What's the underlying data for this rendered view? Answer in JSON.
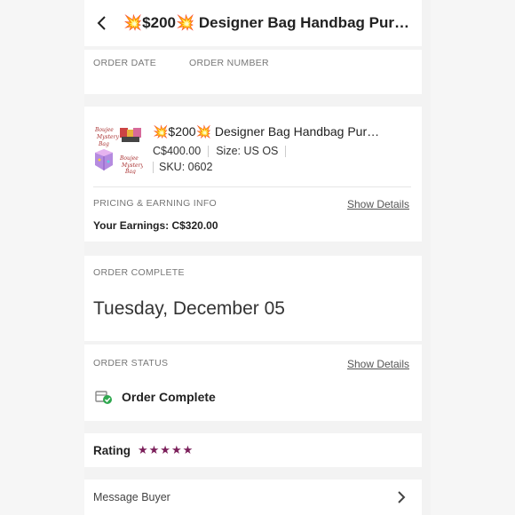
{
  "header": {
    "title": "💥$200💥 Designer Bag Handbag Purse…"
  },
  "meta": {
    "order_date_label": "ORDER DATE",
    "order_number_label": "ORDER NUMBER"
  },
  "product": {
    "name": "💥$200💥 Designer Bag Handbag Pur…",
    "price": "C$400.00",
    "size": "Size: US OS",
    "sku": "SKU: 0602"
  },
  "pricing": {
    "label": "PRICING & EARNING INFO",
    "show_details": "Show Details",
    "earnings": "Your Earnings: C$320.00"
  },
  "order_complete": {
    "label": "ORDER COMPLETE",
    "date": "Tuesday, December 05"
  },
  "order_status": {
    "label": "ORDER STATUS",
    "show_details": "Show Details",
    "status": "Order Complete"
  },
  "rating": {
    "label": "Rating",
    "stars": "★★★★★",
    "value": 5
  },
  "message": {
    "label": "Message Buyer"
  },
  "colors": {
    "accent": "#7b1f5a",
    "status_green": "#2fa84f"
  }
}
